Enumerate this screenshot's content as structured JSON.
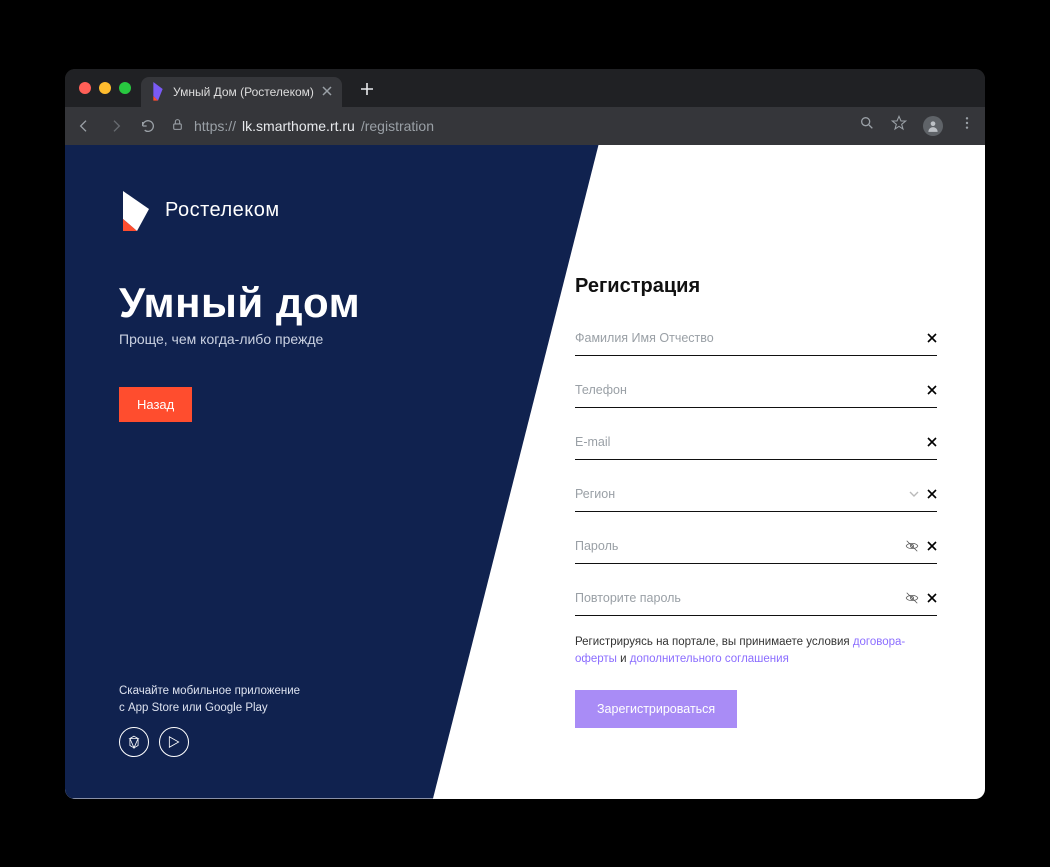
{
  "browser": {
    "tab_title": "Умный Дом (Ростелеком)",
    "url_scheme": "https://",
    "url_host": "lk.smarthome.rt.ru",
    "url_path": "/registration"
  },
  "brand": {
    "company": "Ростелеком",
    "product_title": "Умный дом",
    "product_subtitle": "Проще, чем когда-либо прежде",
    "back_button": "Назад",
    "download_line1": "Скачайте мобильное приложение",
    "download_line2": "с App Store или Google Play"
  },
  "form": {
    "title": "Регистрация",
    "fields": {
      "fullname": {
        "placeholder": "Фамилия Имя Отчество"
      },
      "phone": {
        "placeholder": "Телефон"
      },
      "email": {
        "placeholder": "E-mail"
      },
      "region": {
        "placeholder": "Регион"
      },
      "password": {
        "placeholder": "Пароль"
      },
      "password2": {
        "placeholder": "Повторите пароль"
      }
    },
    "terms": {
      "prefix": "Регистрируясь на портале, вы принимаете условия ",
      "link1": "договора-оферты",
      "mid": " и ",
      "link2": "дополнительного соглашения"
    },
    "submit": "Зарегистрироваться"
  }
}
